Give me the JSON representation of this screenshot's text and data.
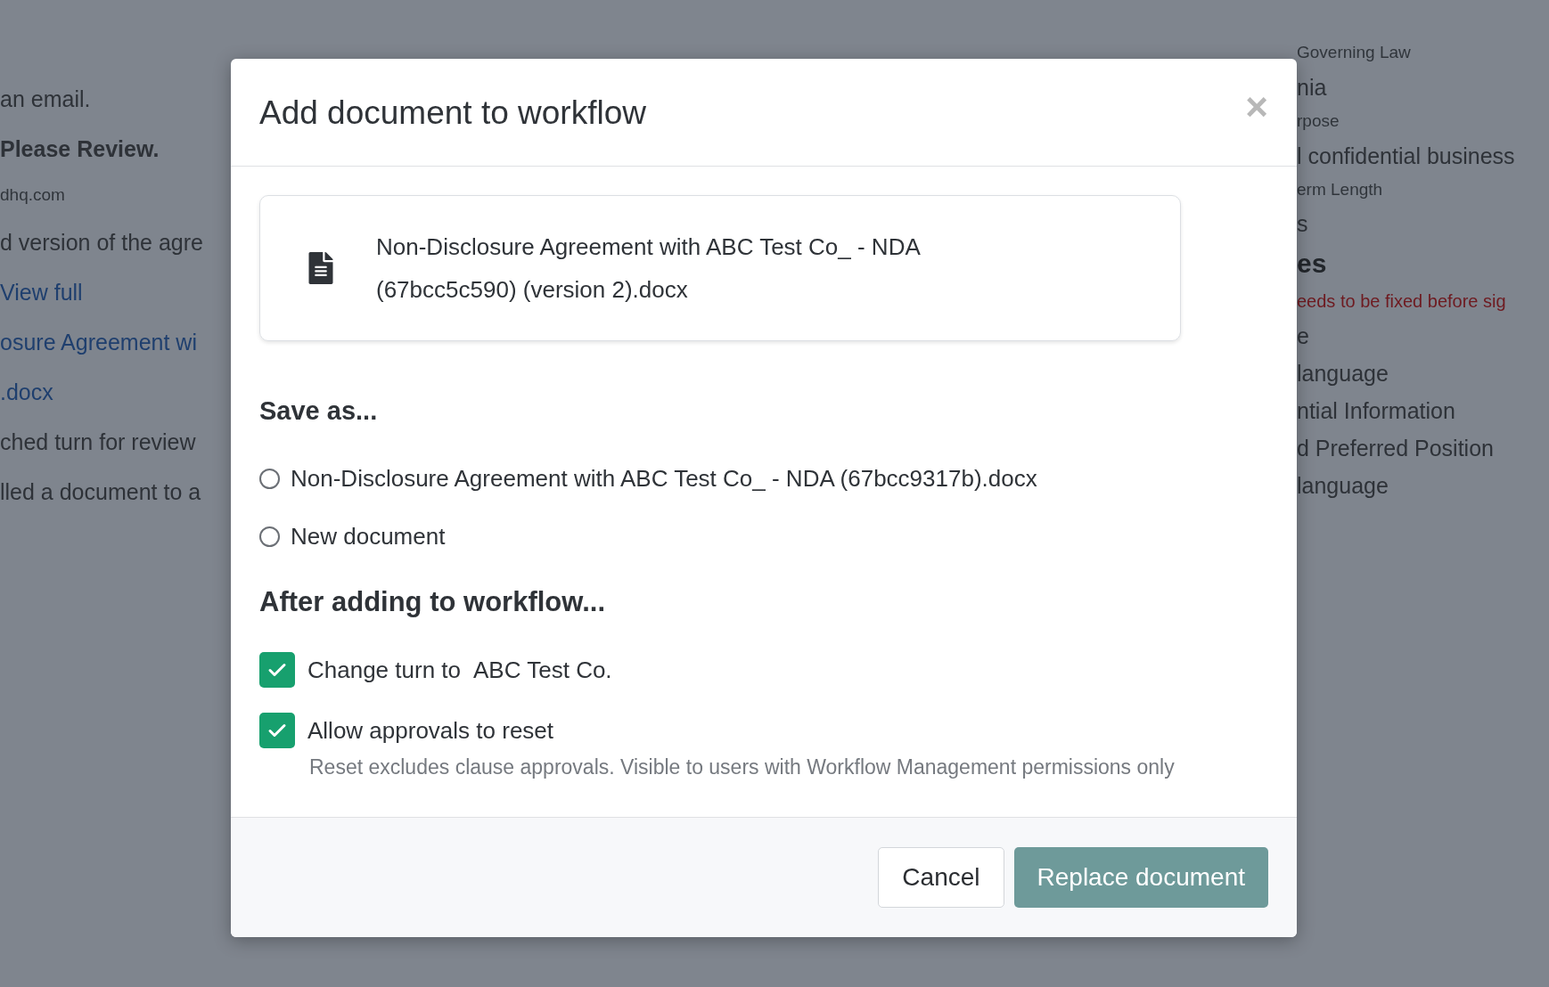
{
  "background": {
    "left": [
      {
        "kind": "text",
        "text": "an email."
      },
      {
        "kind": "strong",
        "text": "Please Review."
      },
      {
        "kind": "muted",
        "text": "dhq.com"
      },
      {
        "kind": "text",
        "text": "d version of the agre"
      },
      {
        "kind": "link",
        "text": "View full"
      },
      {
        "kind": "link",
        "text": "osure Agreement wi"
      },
      {
        "kind": "link",
        "text": ".docx"
      },
      {
        "kind": "text",
        "text": "ched turn for review"
      },
      {
        "kind": "text",
        "text": "lled a document to a"
      }
    ],
    "right": [
      {
        "kind": "muted",
        "text": "Governing Law"
      },
      {
        "kind": "text",
        "text": "nia"
      },
      {
        "kind": "muted",
        "text": "rpose"
      },
      {
        "kind": "text",
        "text": "l confidential business"
      },
      {
        "kind": "muted",
        "text": "erm Length"
      },
      {
        "kind": "text",
        "text": "s"
      },
      {
        "kind": "heading",
        "text": "es"
      },
      {
        "kind": "alert",
        "text": "eeds to be fixed before sig"
      },
      {
        "kind": "text",
        "text": "e"
      },
      {
        "kind": "text",
        "text": "language"
      },
      {
        "kind": "text",
        "text": "ntial Information"
      },
      {
        "kind": "text",
        "text": "d Preferred Position"
      },
      {
        "kind": "text",
        "text": "language"
      }
    ]
  },
  "dialog": {
    "title": "Add document to workflow",
    "close": "×",
    "file": {
      "name": "Non-Disclosure Agreement with ABC Test Co_ - NDA (67bcc5c590) (version 2).docx"
    },
    "save_as": {
      "heading": "Save as...",
      "options": [
        {
          "label": "Non-Disclosure Agreement with ABC Test Co_ - NDA (67bcc9317b).docx",
          "selected": false
        },
        {
          "label": "New document",
          "selected": false
        }
      ]
    },
    "after": {
      "heading": "After adding to workflow...",
      "options": [
        {
          "label": "Change turn to",
          "party": "ABC Test Co.",
          "checked": true
        },
        {
          "label": "Allow approvals to reset",
          "checked": true,
          "hint": "Reset excludes clause approvals. Visible to users with Workflow Management permissions only"
        }
      ]
    },
    "buttons": [
      {
        "label": "Cancel",
        "kind": "secondary"
      },
      {
        "label": "Replace document",
        "kind": "primary"
      }
    ]
  }
}
